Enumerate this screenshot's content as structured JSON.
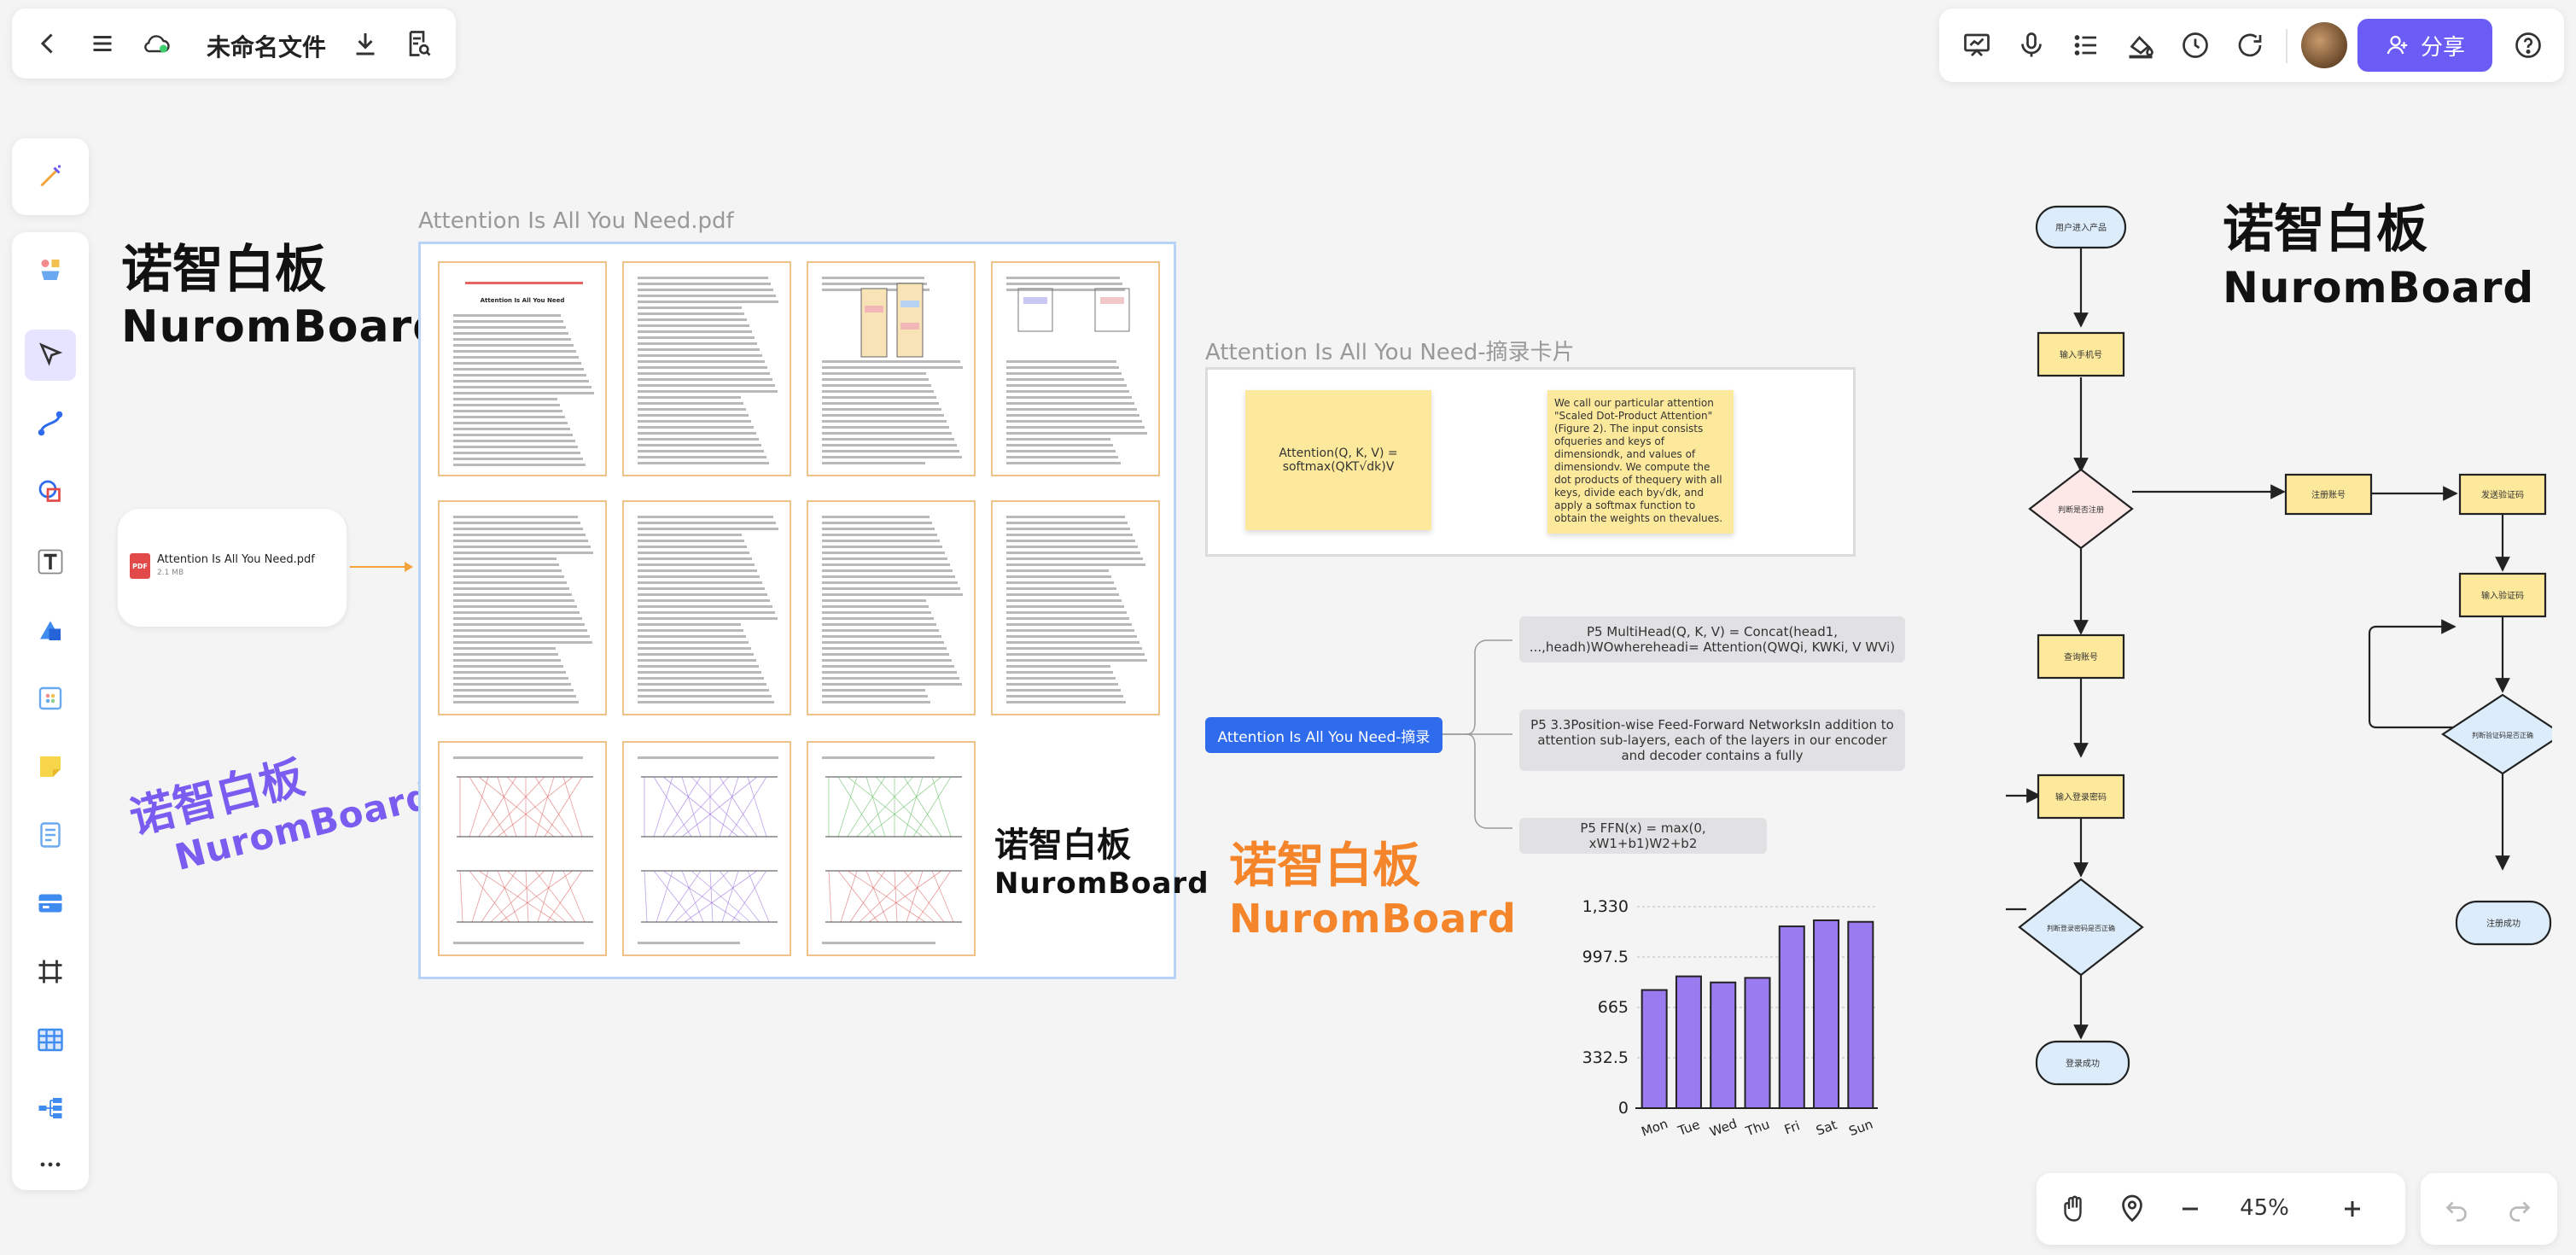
{
  "topbar": {
    "file_name": "未命名文件"
  },
  "righttools": {
    "share_label": "分享"
  },
  "zoom": {
    "level": "45%"
  },
  "brand": {
    "cn": "诺智白板",
    "en": "NuromBoard"
  },
  "pdf": {
    "frame_title": "Attention Is All You Need.pdf",
    "file_card_name": "Attention Is All You Need.pdf",
    "file_card_size": "2.1 MB",
    "paper_title": "Attention Is All You Need"
  },
  "excerpt": {
    "title": "Attention Is All You Need-摘录卡片",
    "card1": "Attention(Q, K, V) = softmax(QKT√dk)V",
    "card2": "We call our particular attention \"Scaled Dot-Product Attention\" (Figure 2). The input consists ofqueries and keys of dimensiondk, and values of dimensiondv. We compute the dot products of thequery with all keys, divide each by√dk, and apply a softmax function to obtain the weights on thevalues."
  },
  "mindmap": {
    "root": "Attention Is All You Need-摘录",
    "children": [
      "P5 MultiHead(Q, K, V) = Concat(head1, ...,headh)WOwhereheadi= Attention(QWQi, KWKi, V WVi)",
      "P5 3.3Position-wise Feed-Forward NetworksIn addition to attention sub-layers, each of the layers in our encoder and decoder contains a fully",
      "P5 FFN(x) = max(0, xW1+b1)W2+b2"
    ]
  },
  "chart_data": {
    "type": "bar",
    "categories": [
      "Mon",
      "Tue",
      "Wed",
      "Thu",
      "Fri",
      "Sat",
      "Sun"
    ],
    "values": [
      780,
      870,
      830,
      860,
      1200,
      1240,
      1230
    ],
    "yticks": [
      "1,330",
      "997.5",
      "665",
      "332.5",
      "0"
    ],
    "ylim": [
      0,
      1330
    ],
    "grid": true,
    "bar_color": "#9b7cf0"
  },
  "flowchart": {
    "nodes": [
      "用户进入产品",
      "输入手机号",
      "判断是否注册",
      "注册账号",
      "发送验证码",
      "查询账号",
      "输入验证码",
      "输入登录密码",
      "判断验证码是否正确",
      "判断登录密码是否正确",
      "注册成功",
      "登录成功"
    ]
  },
  "colors": {
    "accent": "#6b5cf5",
    "mind_root": "#2f6bed",
    "orange_brand": "#f5852a",
    "purple_brand": "#7b5cf0"
  }
}
